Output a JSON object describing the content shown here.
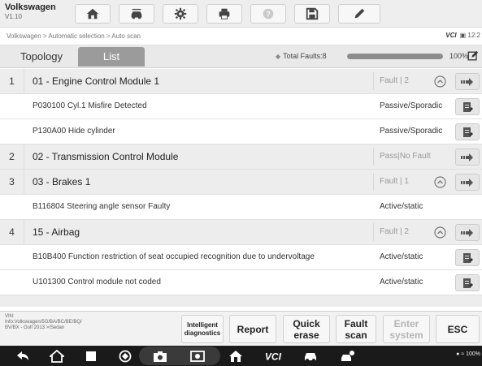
{
  "app": {
    "name": "Volkswagen",
    "version": "V1.10"
  },
  "toolbar": {
    "icons": [
      "home-icon",
      "vehicle-swap-icon",
      "settings-icon",
      "print-icon",
      "help-icon",
      "save-icon",
      "edit-pen-icon"
    ]
  },
  "breadcrumb": "Volkswagen > Automatic selection > Auto scan",
  "header_right": {
    "vci_label": "VCI",
    "time": "12:2"
  },
  "tabs": {
    "topology": "Topology",
    "list": "List",
    "active": "List"
  },
  "summary": {
    "total_faults": "Total Faults:8",
    "progress_percent": 100,
    "progress_label": "100%"
  },
  "rows": [
    {
      "type": "module",
      "num": "1",
      "title": "01 - Engine Control Module 1",
      "status": "Fault | 2",
      "expand": true
    },
    {
      "type": "fault",
      "code": "P030100 Cyl.1  Misfire Detected",
      "status": "Passive/Sporadic"
    },
    {
      "type": "fault",
      "code": "P130A00 Hide cylinder",
      "status": "Passive/Sporadic"
    },
    {
      "type": "module",
      "num": "2",
      "title": "02 - Transmission Control Module",
      "status": "Pass|No Fault",
      "expand": false
    },
    {
      "type": "module",
      "num": "3",
      "title": "03 - Brakes 1",
      "status": "Fault | 1",
      "expand": true
    },
    {
      "type": "fault",
      "code": "B116804 Steering angle sensor  Faulty",
      "status": "Active/static",
      "no_action": true
    },
    {
      "type": "module",
      "num": "4",
      "title": "15 - Airbag",
      "status": "Fault | 2",
      "expand": true
    },
    {
      "type": "fault",
      "code": "B10B400 Function restriction of seat occupied recognition  due to undervoltage",
      "status": "Active/static"
    },
    {
      "type": "fault",
      "code": "U101300 Control module not coded",
      "status": "Active/static"
    }
  ],
  "vin_info": {
    "vin": "VIN:",
    "info": "Info:Volkswagen/5G/BA/BC/BE/BQ/",
    "model": "BV/BX - Golf 2013 >/Sedan"
  },
  "function_buttons": {
    "intelligent": "Intelligent diagnostics",
    "report": "Report",
    "quick_erase": "Quick erase",
    "fault_scan": "Fault scan",
    "enter_system": "Enter system",
    "esc": "ESC"
  },
  "nav_icons": [
    "back-icon",
    "home-icon",
    "recents-icon",
    "browser-icon",
    "camera-icon",
    "screen-record-icon",
    "maxi-home-icon",
    "vci-icon",
    "vehicle-icon",
    "car-user-icon"
  ],
  "system_status": "100%",
  "colors": {
    "module_row_bg": "#ededed",
    "active_tab_bg": "#9b9b9b",
    "nav_bg": "#1a1a1a"
  }
}
